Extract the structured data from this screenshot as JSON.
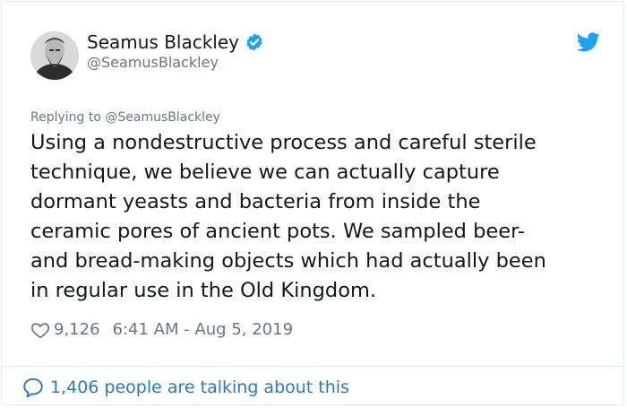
{
  "author": {
    "name": "Seamus Blackley",
    "handle": "@SeamusBlackley"
  },
  "reply_to": "Replying to @SeamusBlackley",
  "body_lines": [
    "Using a nondestructive process and careful sterile",
    "technique, we believe we can actually capture",
    "dormant yeasts and bacteria from inside the",
    "ceramic pores of ancient pots. We sampled beer-",
    "and bread-making objects which had actually been",
    "in regular use in the Old Kingdom."
  ],
  "meta": {
    "likes": "9,126",
    "timestamp": "6:41 AM - Aug 5, 2019"
  },
  "footer": {
    "talking": "1,406 people are talking about this"
  },
  "icons": {
    "verified": "verified-badge-icon",
    "bird": "twitter-bird-icon",
    "heart": "heart-icon",
    "bubble": "speech-bubble-icon"
  },
  "colors": {
    "brand_blue": "#1da1f2",
    "link_blue": "#2b7bb9",
    "muted": "#657786",
    "text": "#14171a"
  }
}
